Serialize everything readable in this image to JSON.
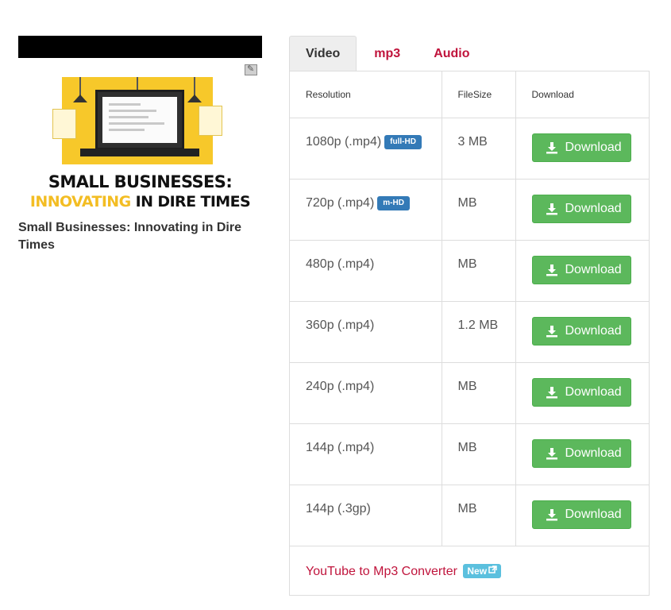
{
  "video": {
    "thumbnail_headline_line1": "SMALL BUSINESSES:",
    "thumbnail_headline_highlight": "INNOVATING",
    "thumbnail_headline_rest": " IN DIRE TIMES",
    "title": "Small Businesses: Innovating in Dire Times"
  },
  "tabs": [
    {
      "label": "Video",
      "active": true
    },
    {
      "label": "mp3",
      "active": false
    },
    {
      "label": "Audio",
      "active": false
    }
  ],
  "table": {
    "headers": {
      "resolution": "Resolution",
      "filesize": "FileSize",
      "download": "Download"
    },
    "rows": [
      {
        "resolution": "1080p (.mp4)",
        "badge": "full-HD",
        "filesize": "3 MB",
        "button": "Download"
      },
      {
        "resolution": "720p (.mp4)",
        "badge": "m-HD",
        "filesize": "MB",
        "button": "Download"
      },
      {
        "resolution": "480p (.mp4)",
        "badge": "",
        "filesize": "MB",
        "button": "Download"
      },
      {
        "resolution": "360p (.mp4)",
        "badge": "",
        "filesize": "1.2 MB",
        "button": "Download"
      },
      {
        "resolution": "240p (.mp4)",
        "badge": "",
        "filesize": "MB",
        "button": "Download"
      },
      {
        "resolution": "144p (.mp4)",
        "badge": "",
        "filesize": "MB",
        "button": "Download"
      },
      {
        "resolution": "144p (.3gp)",
        "badge": "",
        "filesize": "MB",
        "button": "Download"
      }
    ]
  },
  "footer": {
    "link": "YouTube to Mp3 Converter",
    "badge": "New"
  },
  "icons": {
    "download": "download-icon",
    "external": "external-link-icon",
    "thumbnail_corner": "pencil-icon"
  },
  "colors": {
    "accent_link": "#c0143c",
    "download_button": "#5cb85c",
    "hd_badge": "#337ab7",
    "new_badge": "#5bc0de",
    "thumbnail_yellow": "#f7c82a"
  }
}
